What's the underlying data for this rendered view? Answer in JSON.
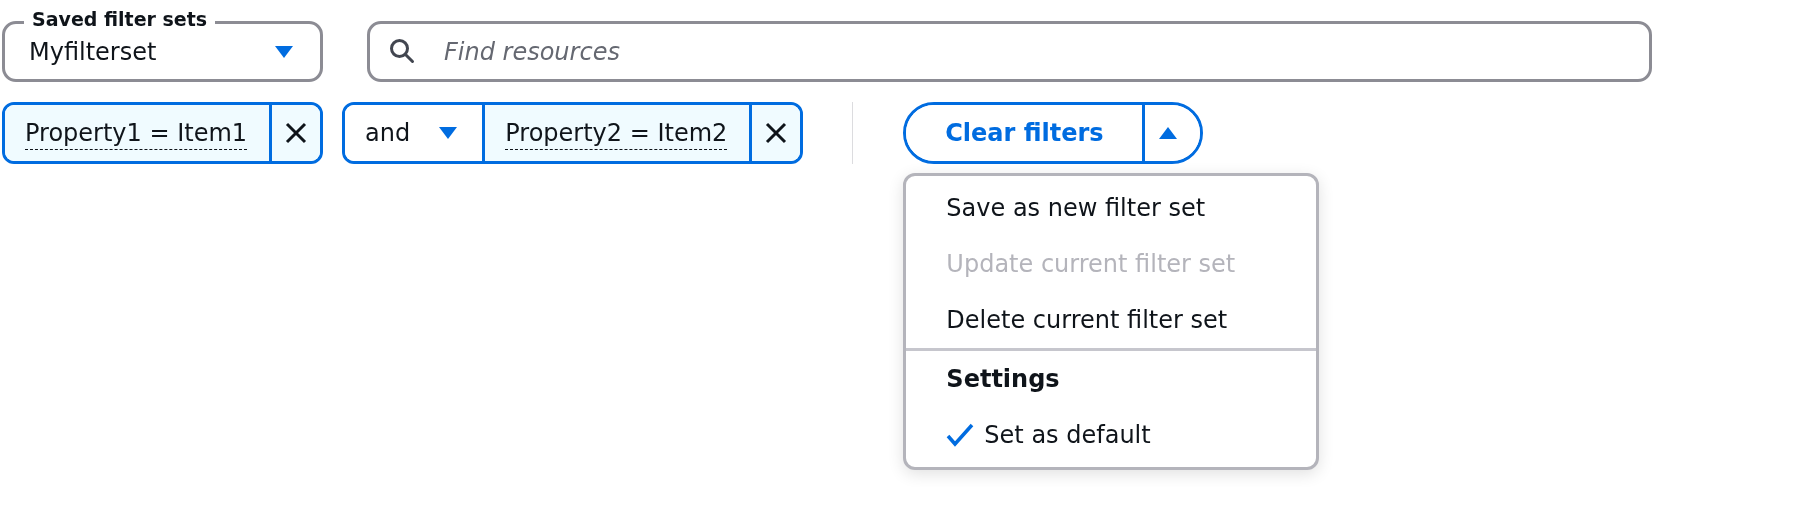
{
  "saved_filter_sets": {
    "label": "Saved filter sets",
    "value": "Myfilterset"
  },
  "search": {
    "placeholder": "Find resources"
  },
  "tokens": [
    {
      "text": "Property1 = Item1"
    },
    {
      "operator": "and",
      "text": "Property2 = Item2"
    }
  ],
  "clear_filters": {
    "label": "Clear filters",
    "menu_expanded": true
  },
  "menu": {
    "items": [
      {
        "kind": "action",
        "label": "Save as new filter set",
        "disabled": false
      },
      {
        "kind": "action",
        "label": "Update current filter set",
        "disabled": true
      },
      {
        "kind": "action",
        "label": "Delete current filter set",
        "disabled": false
      },
      {
        "kind": "group",
        "label": "Settings"
      },
      {
        "kind": "check",
        "label": "Set as default",
        "checked": true
      }
    ]
  }
}
